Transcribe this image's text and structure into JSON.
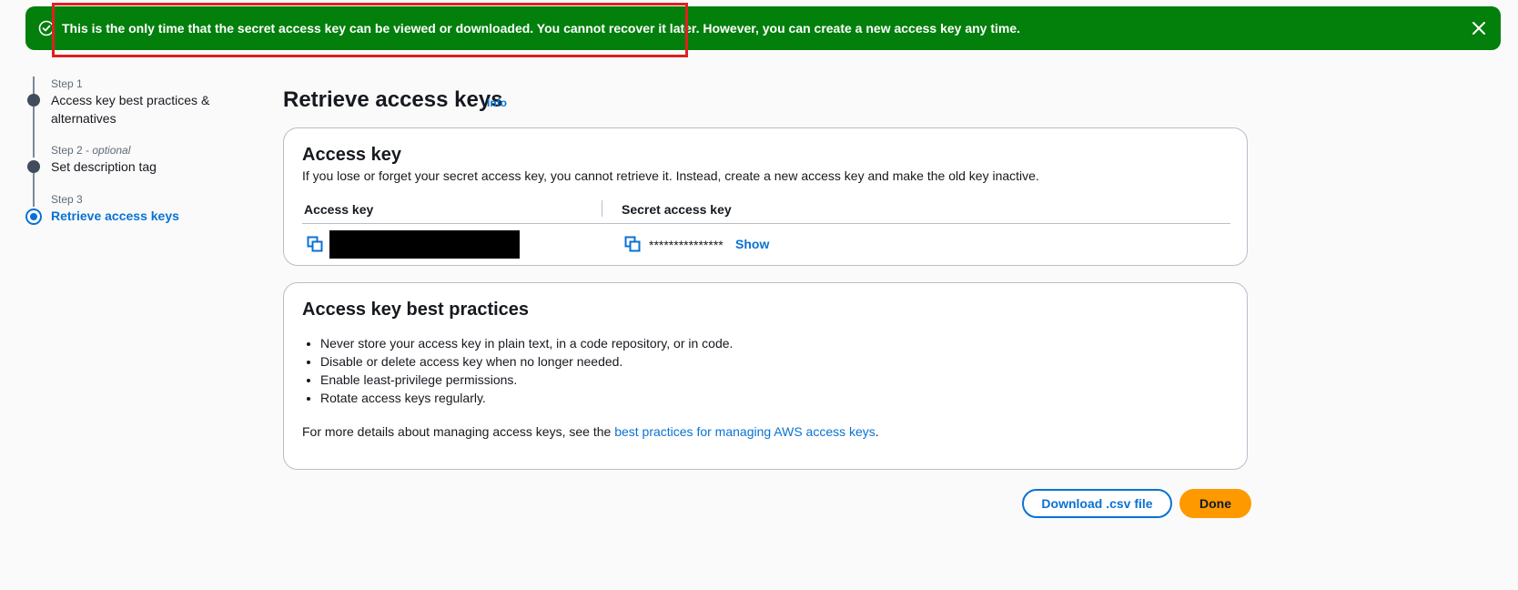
{
  "flash": {
    "message": "This is the only time that the secret access key can be viewed or downloaded. You cannot recover it later. However, you can create a new access key any time.",
    "background": "#037f0c",
    "icon": "check-circle-icon",
    "close_icon": "close-icon"
  },
  "steps": [
    {
      "label": "Step 1",
      "optional": "",
      "title": "Access key best practices & alternatives"
    },
    {
      "label": "Step 2 - ",
      "optional": "optional",
      "title": "Set description tag"
    },
    {
      "label": "Step 3",
      "optional": "",
      "title": "Retrieve access keys"
    }
  ],
  "page": {
    "title": "Retrieve access keys",
    "info_link": "Info"
  },
  "access_key_panel": {
    "title": "Access key",
    "description": "If you lose or forget your secret access key, you cannot retrieve it. Instead, create a new access key and make the old key inactive.",
    "columns": [
      "Access key",
      "Secret access key"
    ],
    "secret_value": "***************",
    "show_label": "Show"
  },
  "best_practices_panel": {
    "title": "Access key best practices",
    "items": [
      "Never store your access key in plain text, in a code repository, or in code.",
      "Disable or delete access key when no longer needed.",
      "Enable least-privilege permissions.",
      "Rotate access keys regularly."
    ],
    "footer_prefix": "For more details about managing access keys, see the ",
    "footer_link": "best practices for managing AWS access keys",
    "footer_suffix": "."
  },
  "actions": {
    "download_label": "Download .csv file",
    "done_label": "Done"
  },
  "colors": {
    "accent": "#0972d3",
    "primary_button": "#ff9900",
    "highlight": "#e02020"
  }
}
